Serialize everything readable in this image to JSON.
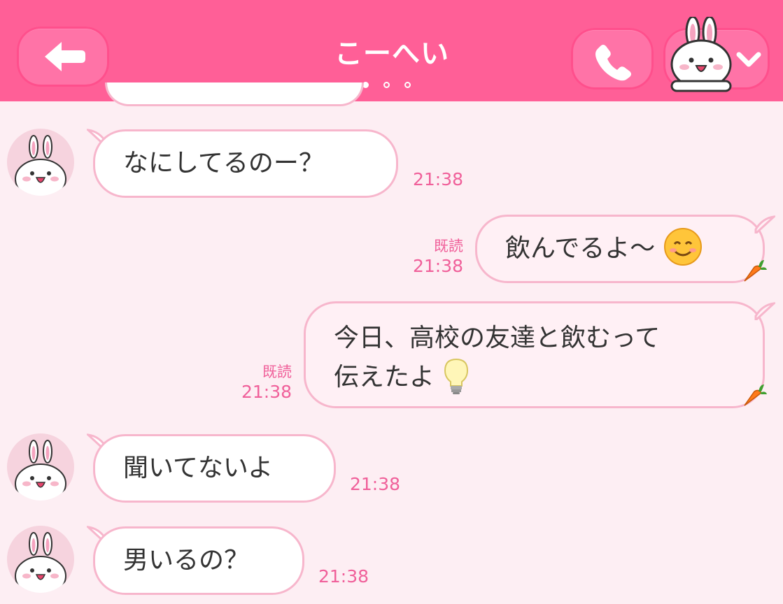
{
  "header": {
    "title": "こーへい",
    "back_icon": "back-arrow-icon",
    "call_icon": "phone-icon",
    "menu_icon": "chevron-down-icon",
    "bg_color": "#ff5f97"
  },
  "messages": [
    {
      "side": "in",
      "text": "なにしてるのー？",
      "time": "21:38"
    },
    {
      "side": "out",
      "text": "飲んでるよ〜",
      "emoji": "smiling-face-icon",
      "read": "既読",
      "time": "21:38"
    },
    {
      "side": "out",
      "line1": "今日、高校の友達と飲むって",
      "line2": "伝えたよ",
      "emoji": "light-bulb-icon",
      "read": "既読",
      "time": "21:38"
    },
    {
      "side": "in",
      "text": "聞いてないよ",
      "time": "21:38"
    },
    {
      "side": "in",
      "text": "男いるの？",
      "time": "21:38"
    }
  ]
}
